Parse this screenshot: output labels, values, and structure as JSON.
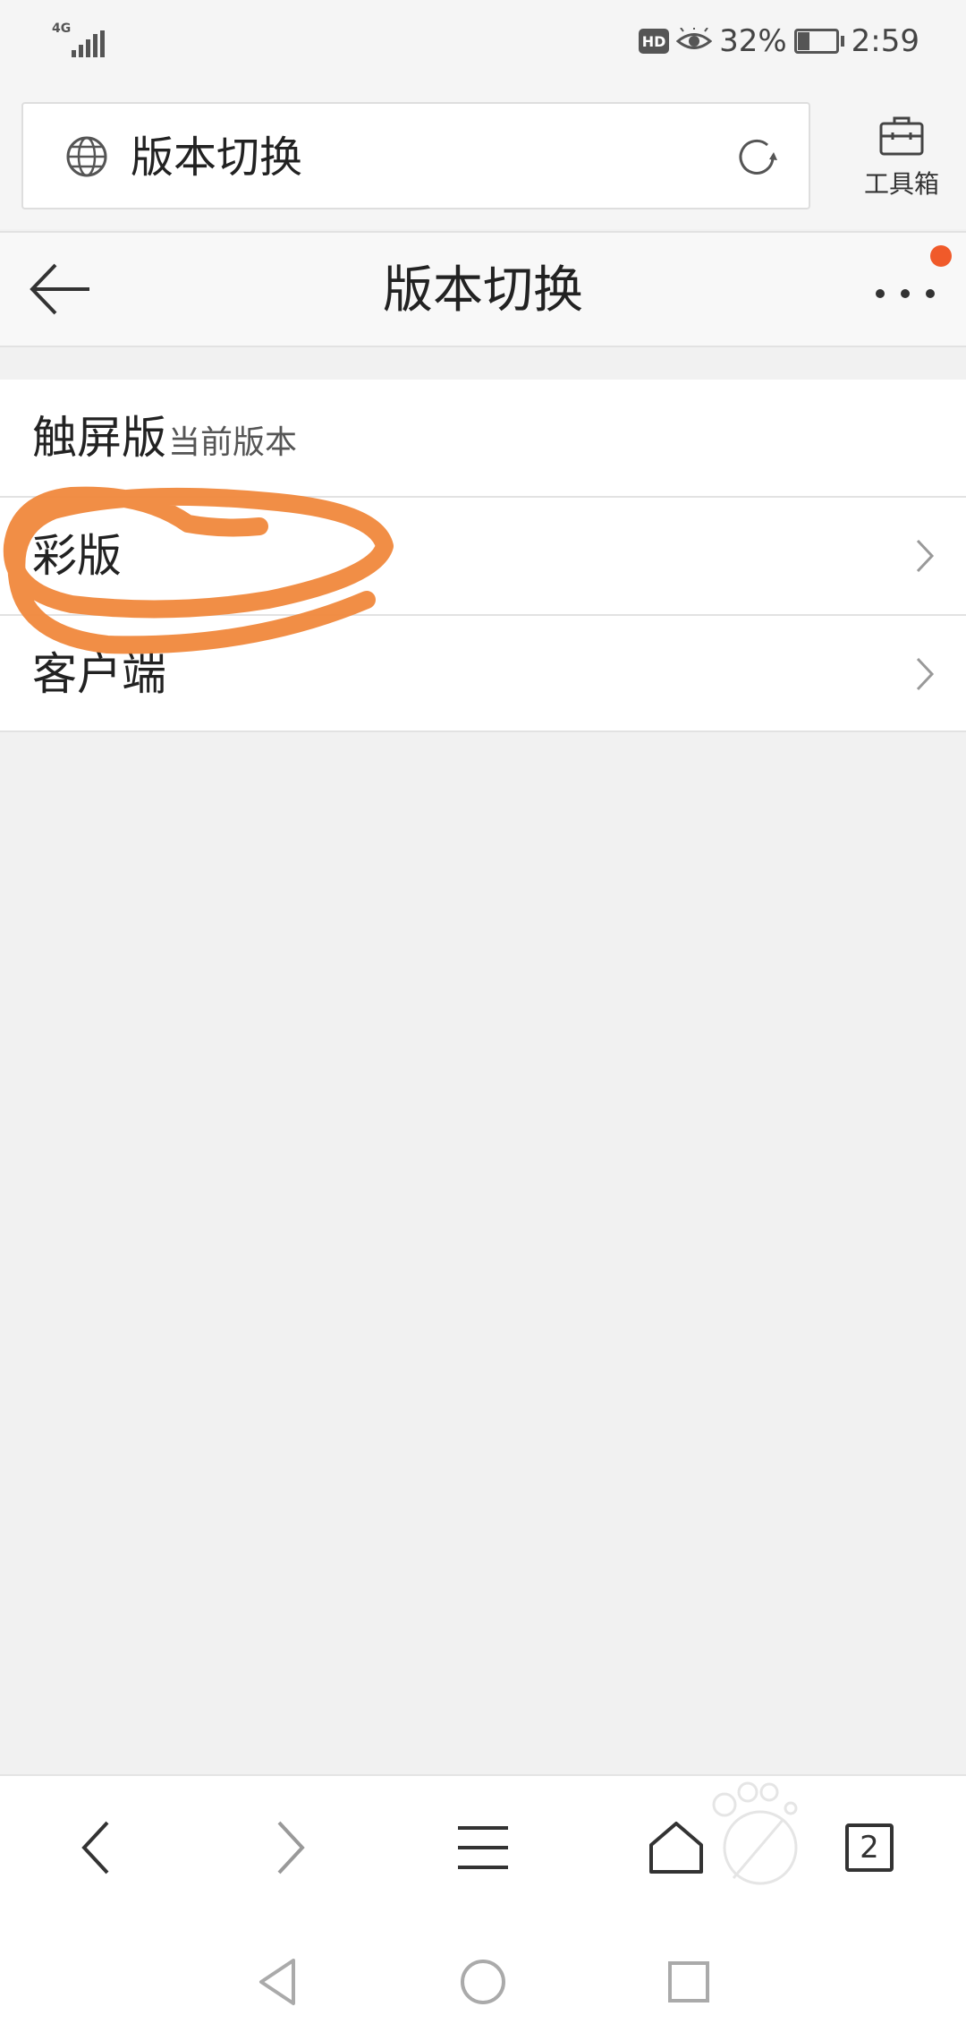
{
  "status_bar": {
    "network": "4G",
    "hd_badge": "HD",
    "battery_percent": "32%",
    "time": "2:59",
    "battery_level": 0.32
  },
  "address_bar": {
    "url_text": "版本切换",
    "toolbox_label": "工具箱"
  },
  "page_header": {
    "title": "版本切换",
    "has_notification": true
  },
  "version_list": [
    {
      "label": "触屏版",
      "sub": "当前版本"
    },
    {
      "label": "彩版",
      "sub": ""
    },
    {
      "label": "客户端",
      "sub": ""
    }
  ],
  "bottom_toolbar": {
    "tab_count": "2"
  },
  "colors": {
    "annotation": "#f0883c",
    "badge": "#f05a2a",
    "background": "#f1f1f1"
  },
  "icons": {
    "back": "back-arrow-icon",
    "more": "more-dots-icon",
    "globe": "globe-icon",
    "refresh": "refresh-icon",
    "toolbox": "toolbox-icon",
    "chevron": "chevron-right-icon"
  }
}
